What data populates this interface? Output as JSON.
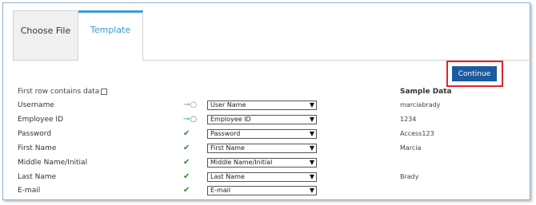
{
  "tabs": {
    "choose_file": "Choose File",
    "template": "Template"
  },
  "toolbar": {
    "continue_label": "Continue"
  },
  "options": {
    "first_row_label": "First row contains data",
    "first_row_checked": false
  },
  "sample_header": "Sample Data",
  "rows": [
    {
      "label": "Username",
      "status": "key",
      "mapping": "User Name",
      "sample": "marciabrady"
    },
    {
      "label": "Employee ID",
      "status": "key-ok",
      "mapping": "Employee ID",
      "sample": "1234"
    },
    {
      "label": "Password",
      "status": "check",
      "mapping": "Password",
      "sample": "Access123"
    },
    {
      "label": "First Name",
      "status": "check",
      "mapping": "First Name",
      "sample": "Marcia"
    },
    {
      "label": "Middle Name/Initial",
      "status": "check",
      "mapping": "Middle Name/Initial",
      "sample": ""
    },
    {
      "label": "Last Name",
      "status": "check",
      "mapping": "Last Name",
      "sample": "Brady"
    },
    {
      "label": "E-mail",
      "status": "check",
      "mapping": "E-mail",
      "sample": ""
    }
  ],
  "colors": {
    "accent": "#3a9bd2",
    "button": "#1b5aa0",
    "highlight": "#e0242b",
    "check": "#2c8a2c"
  }
}
